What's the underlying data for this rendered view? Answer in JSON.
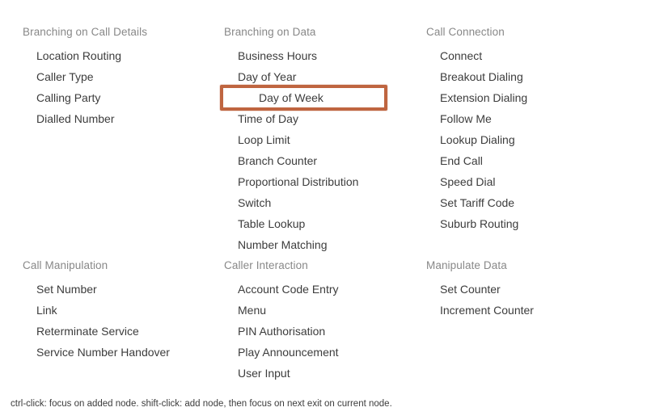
{
  "palette": {
    "accent_color": "#bf6540",
    "header_color": "#888888",
    "item_color": "#3c3c3c",
    "background_color": "#ffffff",
    "rows": [
      {
        "groups": [
          {
            "title": "Branching on Call Details",
            "items": [
              {
                "label": "Location Routing",
                "selected": false
              },
              {
                "label": "Caller Type",
                "selected": false
              },
              {
                "label": "Calling Party",
                "selected": false
              },
              {
                "label": "Dialled Number",
                "selected": false
              }
            ]
          },
          {
            "title": "Branching on Data",
            "items": [
              {
                "label": "Business Hours",
                "selected": false
              },
              {
                "label": "Day of Year",
                "selected": false
              },
              {
                "label": "Day of Week",
                "selected": true
              },
              {
                "label": "Time of Day",
                "selected": false
              },
              {
                "label": "Loop Limit",
                "selected": false
              },
              {
                "label": "Branch Counter",
                "selected": false
              },
              {
                "label": "Proportional Distribution",
                "selected": false
              },
              {
                "label": "Switch",
                "selected": false
              },
              {
                "label": "Table Lookup",
                "selected": false
              },
              {
                "label": "Number Matching",
                "selected": false
              }
            ]
          },
          {
            "title": "Call Connection",
            "items": [
              {
                "label": "Connect",
                "selected": false
              },
              {
                "label": "Breakout Dialing",
                "selected": false
              },
              {
                "label": "Extension Dialing",
                "selected": false
              },
              {
                "label": "Follow Me",
                "selected": false
              },
              {
                "label": "Lookup Dialing",
                "selected": false
              },
              {
                "label": "End Call",
                "selected": false
              },
              {
                "label": "Speed Dial",
                "selected": false
              },
              {
                "label": "Set Tariff Code",
                "selected": false
              },
              {
                "label": "Suburb Routing",
                "selected": false
              }
            ]
          }
        ]
      },
      {
        "groups": [
          {
            "title": "Call Manipulation",
            "items": [
              {
                "label": "Set Number",
                "selected": false
              },
              {
                "label": "Link",
                "selected": false
              },
              {
                "label": "Reterminate Service",
                "selected": false
              },
              {
                "label": "Service Number Handover",
                "selected": false
              }
            ]
          },
          {
            "title": "Caller Interaction",
            "items": [
              {
                "label": "Account Code Entry",
                "selected": false
              },
              {
                "label": "Menu",
                "selected": false
              },
              {
                "label": "PIN Authorisation",
                "selected": false
              },
              {
                "label": "Play Announcement",
                "selected": false
              },
              {
                "label": "User Input",
                "selected": false
              }
            ]
          },
          {
            "title": "Manipulate Data",
            "items": [
              {
                "label": "Set Counter",
                "selected": false
              },
              {
                "label": "Increment Counter",
                "selected": false
              }
            ]
          }
        ]
      }
    ]
  },
  "footer": {
    "hint": "ctrl-click: focus on added node. shift-click: add node, then focus on next exit on current node."
  }
}
